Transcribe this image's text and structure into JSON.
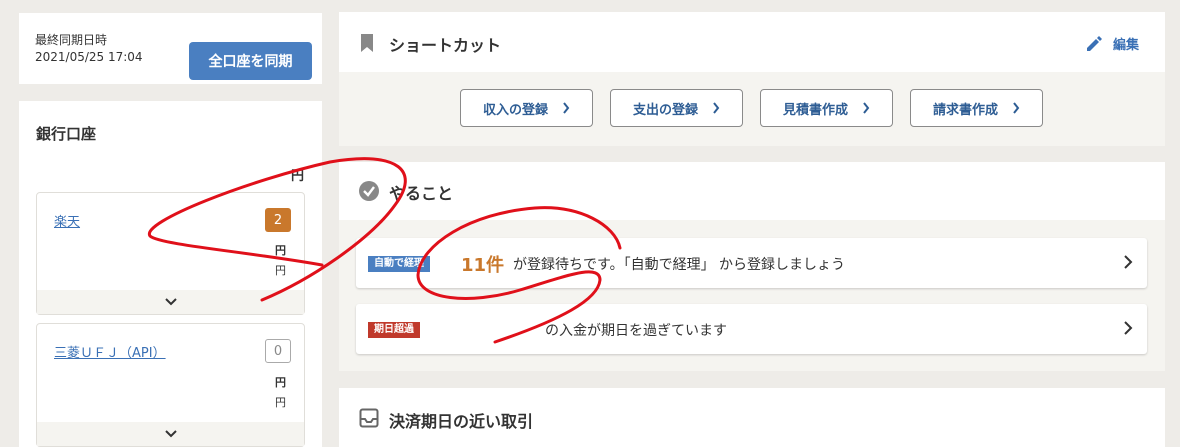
{
  "sync": {
    "label": "最終同期日時",
    "datetime": "2021/05/25 17:04",
    "button_label": "全口座を同期"
  },
  "bank": {
    "title": "銀行口座",
    "total_yen": "円",
    "accounts": [
      {
        "name": "楽天",
        "badge": "2",
        "yen_line1": "円",
        "yen_line2": "円"
      },
      {
        "name": "三菱ＵＦＪ（API）",
        "badge": "0",
        "yen_line1": "円",
        "yen_line2": "円"
      }
    ]
  },
  "shortcut": {
    "title": "ショートカット",
    "edit_label": "編集",
    "buttons": [
      {
        "label": "収入の登録"
      },
      {
        "label": "支出の登録"
      },
      {
        "label": "見積書作成"
      },
      {
        "label": "請求書作成"
      }
    ]
  },
  "todo": {
    "title": "やること",
    "items": [
      {
        "tag": "自動で経理",
        "count": "11件",
        "text": "が登録待ちです。「自動で経理」 から登録しましょう"
      },
      {
        "tag": "期日超過",
        "text": "の入金が期日を過ぎています"
      }
    ]
  },
  "due": {
    "title": "決済期日の近い取引"
  },
  "colors": {
    "primary_button": "#4a7fc1",
    "badge_orange": "#c9782c",
    "tag_auto": "#4a7fc1",
    "tag_overdue": "#c0392b",
    "annotation": "#e0101a"
  },
  "icons": [
    "bookmark-icon",
    "pencil-icon",
    "check-circle-icon",
    "inbox-icon",
    "chevron-right-icon",
    "chevron-down-icon"
  ]
}
